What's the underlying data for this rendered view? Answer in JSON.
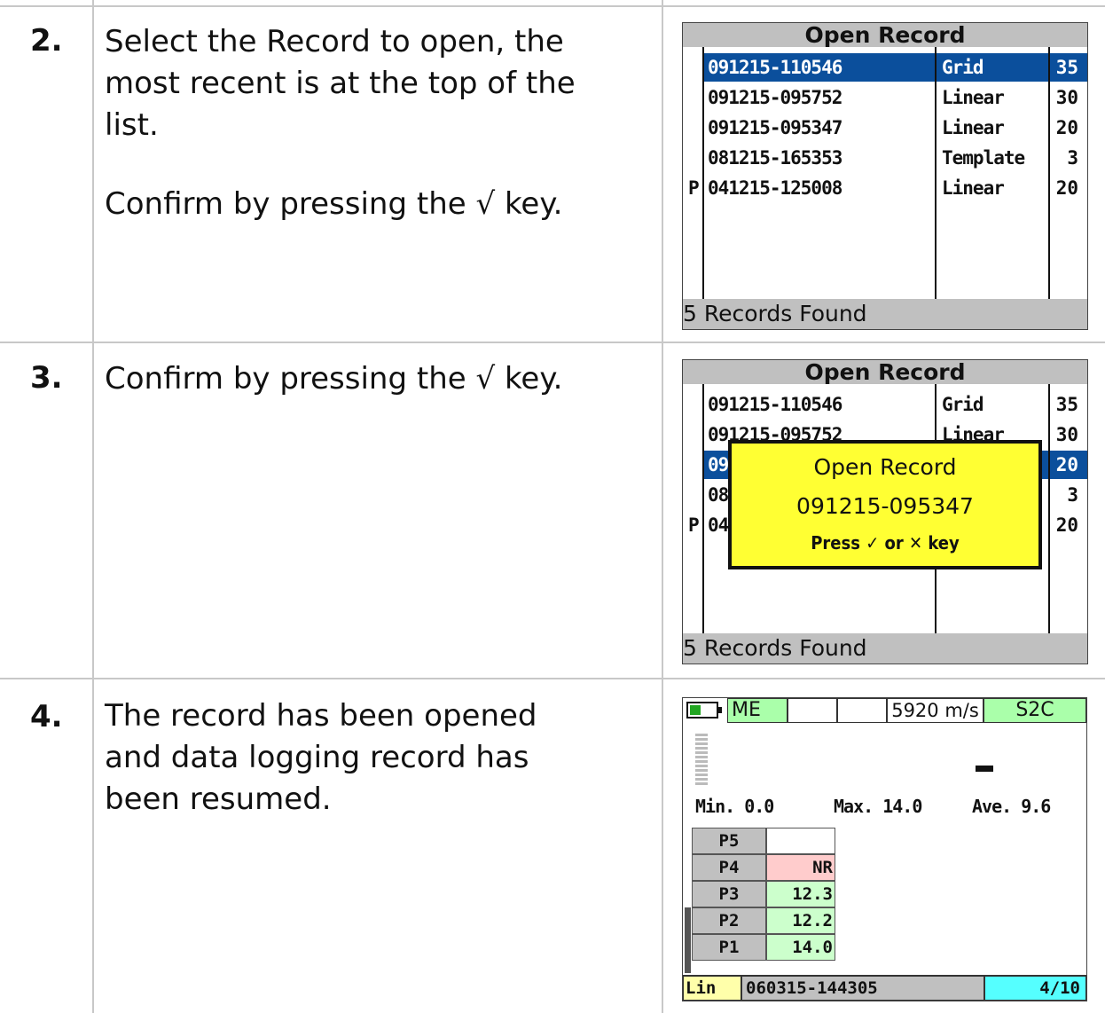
{
  "steps": [
    {
      "number": "2.",
      "text_lines": [
        "Select the Record to open, the most recent is at the top of the list.",
        "Confirm by pressing the √ key."
      ]
    },
    {
      "number": "3.",
      "text_lines": [
        "Confirm by pressing the √ key."
      ]
    },
    {
      "number": "4.",
      "text_lines": [
        "The record has been opened and data logging record has been resumed."
      ]
    }
  ],
  "screen1": {
    "title": "Open Record",
    "rows": [
      {
        "prefix": "",
        "name": "091215-110546",
        "type": "Grid",
        "count": "35"
      },
      {
        "prefix": "",
        "name": "091215-095752",
        "type": "Linear",
        "count": "30"
      },
      {
        "prefix": "",
        "name": "091215-095347",
        "type": "Linear",
        "count": "20"
      },
      {
        "prefix": "",
        "name": "081215-165353",
        "type": "Template",
        "count": "3"
      },
      {
        "prefix": "P",
        "name": "041215-125008",
        "type": "Linear",
        "count": "20"
      }
    ],
    "footer": "5 Records Found"
  },
  "screen2": {
    "title": "Open Record",
    "rows": [
      {
        "prefix": "",
        "name": "091215-110546",
        "type": "Grid",
        "count": "35"
      },
      {
        "prefix": "",
        "name": "091215-095752",
        "type": "Linear",
        "count": "30"
      },
      {
        "prefix": "",
        "name": "09",
        "type": "",
        "count": "20"
      },
      {
        "prefix": "",
        "name": "08",
        "type": "",
        "count": "3"
      },
      {
        "prefix": "P",
        "name": "04",
        "type": "",
        "count": "20"
      }
    ],
    "popup": {
      "title": "Open Record",
      "record": "091215-095347",
      "hint": "Press ✓ or ✕ key"
    },
    "footer": "5 Records Found"
  },
  "screen3": {
    "mode": "ME",
    "velocity": "5920 m/s",
    "probe": "S2C",
    "reading": "-",
    "min": "Min. 0.0",
    "max": "Max. 14.0",
    "ave": "Ave. 9.6",
    "points": [
      {
        "label": "P5",
        "value": ""
      },
      {
        "label": "P4",
        "value": "NR"
      },
      {
        "label": "P3",
        "value": "12.3"
      },
      {
        "label": "P2",
        "value": "12.2"
      },
      {
        "label": "P1",
        "value": "14.0"
      }
    ],
    "record_type": "Lin",
    "record_name": "060315-144305",
    "position": "4/10"
  },
  "colors": {
    "selection": "#0b4f9c",
    "popup": "#ffff33",
    "mode_badge": "#aaffaa",
    "nr_cell": "#ffcccc",
    "value_cell": "#ccffcc",
    "position_cell": "#55ffff",
    "record_type_cell": "#ffffaa"
  }
}
